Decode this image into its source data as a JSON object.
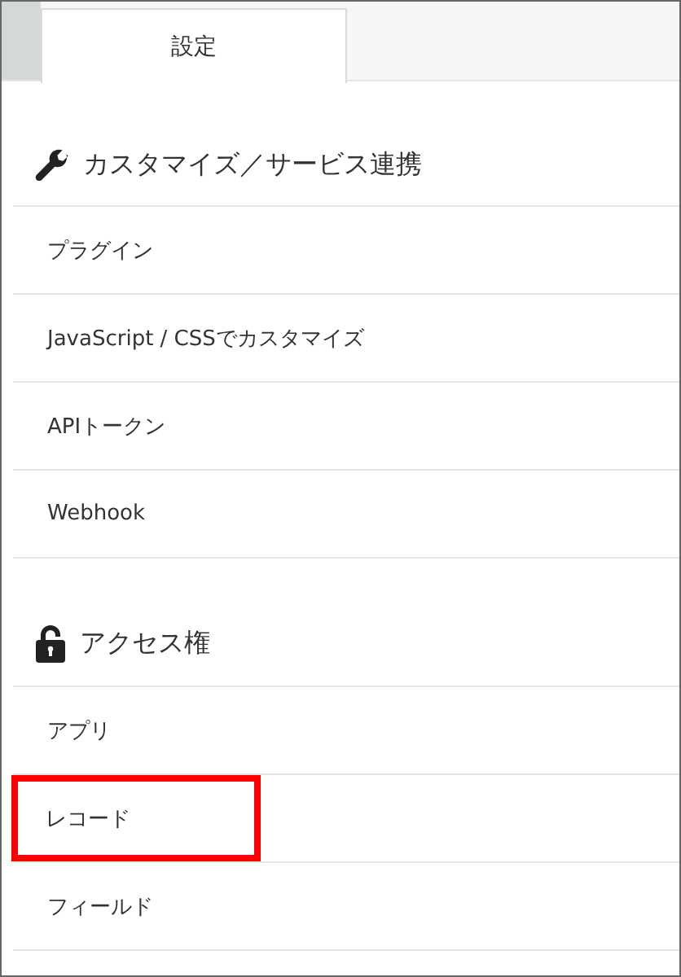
{
  "tabs": [
    {
      "label": "設定",
      "selected": true
    }
  ],
  "sections": [
    {
      "title": "カスタマイズ／サービス連携",
      "kind": "customize",
      "items": [
        {
          "label": "プラグイン",
          "highlighted": false
        },
        {
          "label": "JavaScript / CSSでカスタマイズ",
          "highlighted": false
        },
        {
          "label": "APIトークン",
          "highlighted": false
        },
        {
          "label": "Webhook",
          "highlighted": false
        }
      ]
    },
    {
      "title": "アクセス権",
      "kind": "access",
      "items": [
        {
          "label": "アプリ",
          "highlighted": false
        },
        {
          "label": "レコード",
          "highlighted": true
        },
        {
          "label": "フィールド",
          "highlighted": false
        }
      ]
    }
  ]
}
